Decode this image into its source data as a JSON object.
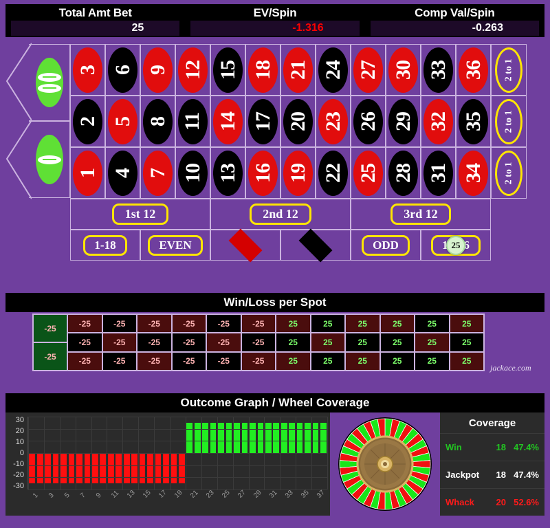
{
  "header": {
    "stats": [
      {
        "label": "Total Amt Bet",
        "value": "25",
        "negative": false
      },
      {
        "label": "EV/Spin",
        "value": "-1.316",
        "negative": true
      },
      {
        "label": "Comp Val/Spin",
        "value": "-0.263",
        "negative": false
      }
    ]
  },
  "table": {
    "zeros": [
      {
        "label": "00",
        "digits": 2
      },
      {
        "label": "0",
        "digits": 1
      }
    ],
    "numbers": [
      {
        "n": "3",
        "color": "red"
      },
      {
        "n": "6",
        "color": "black"
      },
      {
        "n": "9",
        "color": "red"
      },
      {
        "n": "12",
        "color": "red"
      },
      {
        "n": "15",
        "color": "black"
      },
      {
        "n": "18",
        "color": "red"
      },
      {
        "n": "21",
        "color": "red"
      },
      {
        "n": "24",
        "color": "black"
      },
      {
        "n": "27",
        "color": "red"
      },
      {
        "n": "30",
        "color": "red"
      },
      {
        "n": "33",
        "color": "black"
      },
      {
        "n": "36",
        "color": "red"
      },
      {
        "n": "2",
        "color": "black"
      },
      {
        "n": "5",
        "color": "red"
      },
      {
        "n": "8",
        "color": "black"
      },
      {
        "n": "11",
        "color": "black"
      },
      {
        "n": "14",
        "color": "red"
      },
      {
        "n": "17",
        "color": "black"
      },
      {
        "n": "20",
        "color": "black"
      },
      {
        "n": "23",
        "color": "red"
      },
      {
        "n": "26",
        "color": "black"
      },
      {
        "n": "29",
        "color": "black"
      },
      {
        "n": "32",
        "color": "red"
      },
      {
        "n": "35",
        "color": "black"
      },
      {
        "n": "1",
        "color": "red"
      },
      {
        "n": "4",
        "color": "black"
      },
      {
        "n": "7",
        "color": "red"
      },
      {
        "n": "10",
        "color": "black"
      },
      {
        "n": "13",
        "color": "black"
      },
      {
        "n": "16",
        "color": "red"
      },
      {
        "n": "19",
        "color": "red"
      },
      {
        "n": "22",
        "color": "black"
      },
      {
        "n": "25",
        "color": "red"
      },
      {
        "n": "28",
        "color": "black"
      },
      {
        "n": "31",
        "color": "black"
      },
      {
        "n": "34",
        "color": "red"
      }
    ],
    "column_bets": [
      "2 to 1",
      "2 to 1",
      "2 to 1"
    ],
    "dozens": [
      "1st 12",
      "2nd 12",
      "3rd 12"
    ],
    "outside": [
      {
        "type": "text",
        "label": "1-18"
      },
      {
        "type": "text",
        "label": "EVEN"
      },
      {
        "type": "diamond",
        "label": "",
        "color": "red"
      },
      {
        "type": "diamond",
        "label": "",
        "color": "black"
      },
      {
        "type": "text",
        "label": "ODD"
      },
      {
        "type": "text",
        "label": "19-36",
        "chip": "25"
      }
    ]
  },
  "winloss": {
    "title": "Win/Loss per Spot",
    "watermark": "jackace.com",
    "green_cells": [
      "-25",
      "-25"
    ],
    "cells": [
      {
        "v": "-25",
        "color": "red",
        "sign": "loss"
      },
      {
        "v": "-25",
        "color": "black",
        "sign": "loss"
      },
      {
        "v": "-25",
        "color": "red",
        "sign": "loss"
      },
      {
        "v": "-25",
        "color": "red",
        "sign": "loss"
      },
      {
        "v": "-25",
        "color": "black",
        "sign": "loss"
      },
      {
        "v": "-25",
        "color": "red",
        "sign": "loss"
      },
      {
        "v": "25",
        "color": "red",
        "sign": "win"
      },
      {
        "v": "25",
        "color": "black",
        "sign": "win"
      },
      {
        "v": "25",
        "color": "red",
        "sign": "win"
      },
      {
        "v": "25",
        "color": "red",
        "sign": "win"
      },
      {
        "v": "25",
        "color": "black",
        "sign": "win"
      },
      {
        "v": "25",
        "color": "red",
        "sign": "win"
      },
      {
        "v": "-25",
        "color": "black",
        "sign": "loss"
      },
      {
        "v": "-25",
        "color": "red",
        "sign": "loss"
      },
      {
        "v": "-25",
        "color": "black",
        "sign": "loss"
      },
      {
        "v": "-25",
        "color": "black",
        "sign": "loss"
      },
      {
        "v": "-25",
        "color": "red",
        "sign": "loss"
      },
      {
        "v": "-25",
        "color": "black",
        "sign": "loss"
      },
      {
        "v": "25",
        "color": "black",
        "sign": "win"
      },
      {
        "v": "25",
        "color": "red",
        "sign": "win"
      },
      {
        "v": "25",
        "color": "black",
        "sign": "win"
      },
      {
        "v": "25",
        "color": "black",
        "sign": "win"
      },
      {
        "v": "25",
        "color": "red",
        "sign": "win"
      },
      {
        "v": "25",
        "color": "black",
        "sign": "win"
      },
      {
        "v": "-25",
        "color": "red",
        "sign": "loss"
      },
      {
        "v": "-25",
        "color": "black",
        "sign": "loss"
      },
      {
        "v": "-25",
        "color": "red",
        "sign": "loss"
      },
      {
        "v": "-25",
        "color": "black",
        "sign": "loss"
      },
      {
        "v": "-25",
        "color": "black",
        "sign": "loss"
      },
      {
        "v": "-25",
        "color": "red",
        "sign": "loss"
      },
      {
        "v": "25",
        "color": "red",
        "sign": "win"
      },
      {
        "v": "25",
        "color": "black",
        "sign": "win"
      },
      {
        "v": "25",
        "color": "red",
        "sign": "win"
      },
      {
        "v": "25",
        "color": "black",
        "sign": "win"
      },
      {
        "v": "25",
        "color": "black",
        "sign": "win"
      },
      {
        "v": "25",
        "color": "red",
        "sign": "win"
      }
    ]
  },
  "outcome": {
    "title": "Outcome Graph / Wheel Coverage"
  },
  "coverage": {
    "title": "Coverage",
    "rows": [
      {
        "name": "Win",
        "count": "18",
        "pct": "47.4%",
        "style": "win"
      },
      {
        "name": "Jackpot",
        "count": "18",
        "pct": "47.4%",
        "style": "jackpot"
      },
      {
        "name": "Whack",
        "count": "20",
        "pct": "52.6%",
        "style": "whack"
      }
    ]
  },
  "chart_data": {
    "type": "bar",
    "title": "Outcome Graph / Wheel Coverage",
    "xlabel": "",
    "ylabel": "",
    "ylim": [
      -30,
      30
    ],
    "yticks": [
      30,
      20,
      10,
      0,
      -10,
      -20,
      -30
    ],
    "grid": true,
    "legend": "none",
    "x": [
      1,
      2,
      3,
      4,
      5,
      6,
      7,
      8,
      9,
      10,
      11,
      12,
      13,
      14,
      15,
      16,
      17,
      18,
      19,
      20,
      21,
      22,
      23,
      24,
      25,
      26,
      27,
      28,
      29,
      30,
      31,
      32,
      33,
      34,
      35,
      36,
      37,
      38
    ],
    "xtick_labels": [
      "1",
      "3",
      "5",
      "7",
      "9",
      "11",
      "13",
      "15",
      "17",
      "19",
      "21",
      "23",
      "25",
      "27",
      "29",
      "31",
      "33",
      "35",
      "37"
    ],
    "values": [
      -25,
      -25,
      -25,
      -25,
      -25,
      -25,
      -25,
      -25,
      -25,
      -25,
      -25,
      -25,
      -25,
      -25,
      -25,
      -25,
      -25,
      -25,
      -25,
      -25,
      25,
      25,
      25,
      25,
      25,
      25,
      25,
      25,
      25,
      25,
      25,
      25,
      25,
      25,
      25,
      25,
      25,
      25
    ],
    "bar_colors": {
      "negative": "#ff0f0f",
      "positive": "#22ee22"
    }
  },
  "colors": {
    "felt": "#6f3f9e",
    "accent_yellow": "#ffe600",
    "red": "#e10d0d",
    "green": "#5fe035",
    "win_green": "#7dff6b",
    "loss_pink": "#ffb3b3"
  }
}
